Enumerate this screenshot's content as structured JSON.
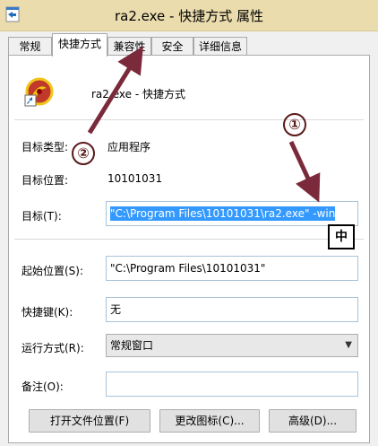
{
  "window": {
    "title": "ra2.exe - 快捷方式 属性"
  },
  "tabs": [
    {
      "label": "常规"
    },
    {
      "label": "快捷方式",
      "active": true
    },
    {
      "label": "兼容性"
    },
    {
      "label": "安全"
    },
    {
      "label": "详细信息"
    }
  ],
  "header": {
    "name": "ra2.exe - 快捷方式"
  },
  "info": {
    "target_type_label": "目标类型:",
    "target_type_value": "应用程序",
    "target_location_label": "目标位置:",
    "target_location_value": "10101031"
  },
  "target": {
    "label": "目标(T):",
    "value_selected": "\"C:\\Program Files\\10101031\\ra2.exe\" -win"
  },
  "ime_indicator": "中",
  "start_in": {
    "label": "起始位置(S):",
    "value": "\"C:\\Program Files\\10101031\""
  },
  "shortcut_key": {
    "label": "快捷键(K):",
    "value": "无"
  },
  "run": {
    "label": "运行方式(R):",
    "value": "常规窗口"
  },
  "comment": {
    "label": "备注(O):",
    "value": ""
  },
  "buttons": {
    "open_location": "打开文件位置(F)",
    "change_icon": "更改图标(C)...",
    "advanced": "高级(D)..."
  },
  "annotations": {
    "marker_1": "①",
    "marker_2": "②"
  },
  "colors": {
    "titlebar": "#ebdcae",
    "selection": "#3399ff",
    "arrow": "#7a2a3a"
  }
}
